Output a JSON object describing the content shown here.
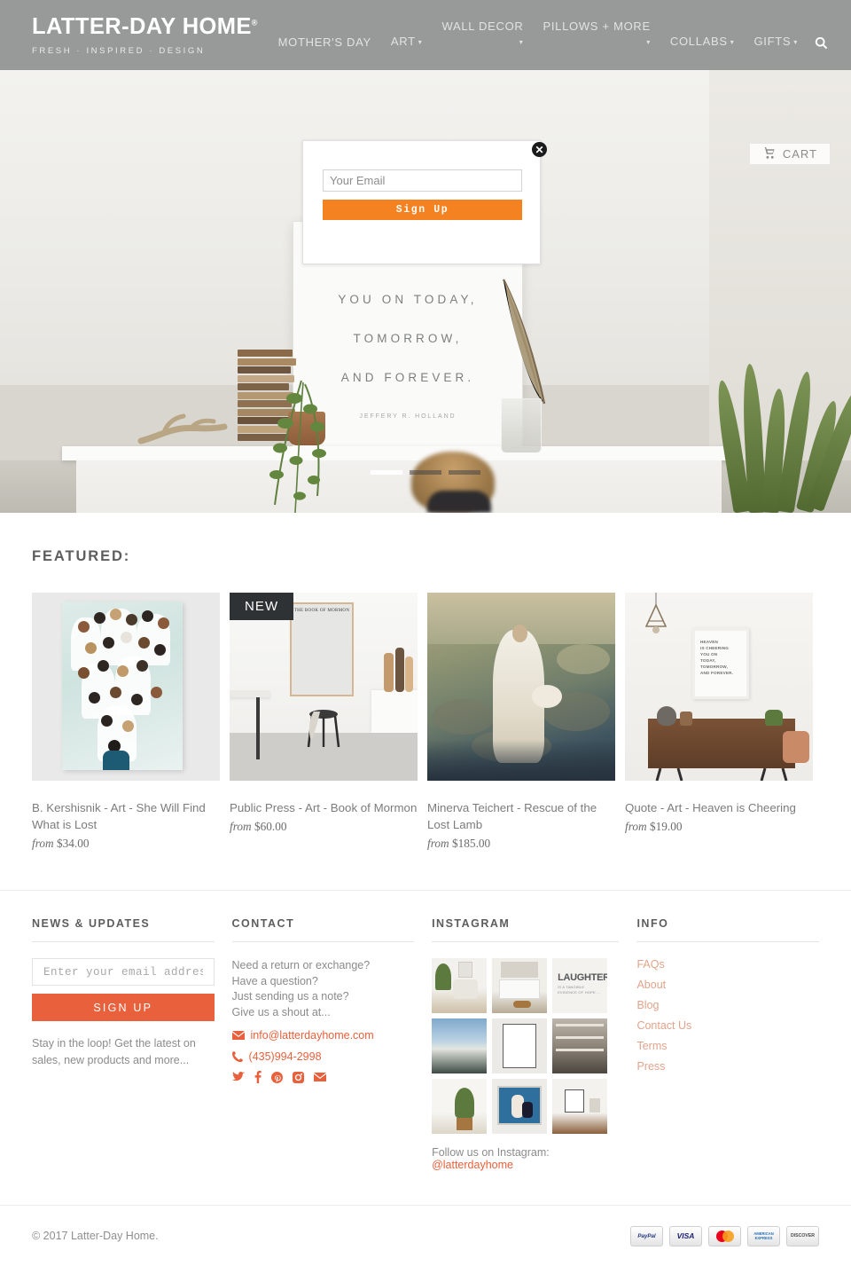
{
  "header": {
    "logo": "LATTER-DAY HOME",
    "logo_trademark": "®",
    "tagline": "FRESH · INSPIRED · DESIGN",
    "nav": [
      {
        "label": "MOTHER'S DAY",
        "caret": ""
      },
      {
        "label": "ART",
        "caret": "▾"
      },
      {
        "label": "WALL DECOR",
        "caret": "▾"
      },
      {
        "label": "PILLOWS + MORE",
        "caret": "▾"
      },
      {
        "label": "COLLABS",
        "caret": "▾"
      },
      {
        "label": "GIFTS",
        "caret": "▾"
      }
    ],
    "search_icon": "search-icon",
    "cart_label": "CART",
    "cart_icon": "cart-icon"
  },
  "popup": {
    "email_placeholder": "Your Email",
    "email_value": "",
    "signup_label": "Sign Up",
    "close_label": "✕",
    "accent": "#f58220"
  },
  "hero": {
    "poster_lines": [
      "YOU ON TODAY,",
      "TOMORROW,",
      "AND FOREVER."
    ],
    "poster_author": "JEFFERY R. HOLLAND",
    "slides": 3,
    "active_slide": 1
  },
  "featured": {
    "title": "FEATURED:",
    "new_badge": "NEW",
    "products": [
      {
        "title": "B. Kershisnik - Art - She Will Find What is Lost",
        "price_prefix": "from",
        "price": "$34.00",
        "badge": ""
      },
      {
        "title": "Public Press - Art - Book of Mormon",
        "price_prefix": "from",
        "price": "$60.00",
        "badge": "NEW",
        "art_text": "THE BOOK OF MORMON"
      },
      {
        "title": "Minerva Teichert - Rescue of the Lost Lamb",
        "price_prefix": "from",
        "price": "$185.00",
        "badge": ""
      },
      {
        "title": "Quote - Art - Heaven is Cheering",
        "price_prefix": "from",
        "price": "$19.00",
        "badge": "",
        "art_lines": [
          "HEAVEN",
          "IS CHEERING",
          "YOU ON",
          "TODAY,",
          "TOMORROW,",
          "AND FOREVER."
        ]
      }
    ]
  },
  "footer": {
    "news": {
      "heading": "NEWS & UPDATES",
      "input_placeholder": "Enter your email address...",
      "input_value": "",
      "button_label": "SIGN UP",
      "note": "Stay in the loop! Get the latest on sales, new products and more..."
    },
    "contact": {
      "heading": "CONTACT",
      "lines": [
        "Need a return or exchange?",
        "Have a question?",
        "Just sending us a note?",
        "Give us a shout at..."
      ],
      "email": "info@latterdayhome.com",
      "email_icon": "envelope-icon",
      "phone": "(435)994-2998",
      "phone_icon": "phone-icon",
      "socials": [
        {
          "name": "twitter-icon",
          "glyph": "t"
        },
        {
          "name": "facebook-icon",
          "glyph": "f"
        },
        {
          "name": "pinterest-icon",
          "glyph": "p"
        },
        {
          "name": "instagram-icon",
          "glyph": "i"
        },
        {
          "name": "email-icon",
          "glyph": "e"
        }
      ]
    },
    "instagram": {
      "heading": "INSTAGRAM",
      "caption_prefix": "Follow us on Instagram: ",
      "handle": "@latterdayhome",
      "tile_text": "LAUGHTER",
      "tile_subtext": "IS A TANGIBLE EVIDENCE OF HOPE ..."
    },
    "info": {
      "heading": "INFO",
      "links": [
        "FAQs",
        "About",
        "Blog",
        "Contact Us",
        "Terms",
        "Press"
      ]
    },
    "copyright": "© 2017 Latter-Day Home.",
    "payments": [
      "PayPal",
      "VISA",
      "MasterCard",
      "AMERICAN EXPRESS",
      "DISCOVER"
    ]
  }
}
